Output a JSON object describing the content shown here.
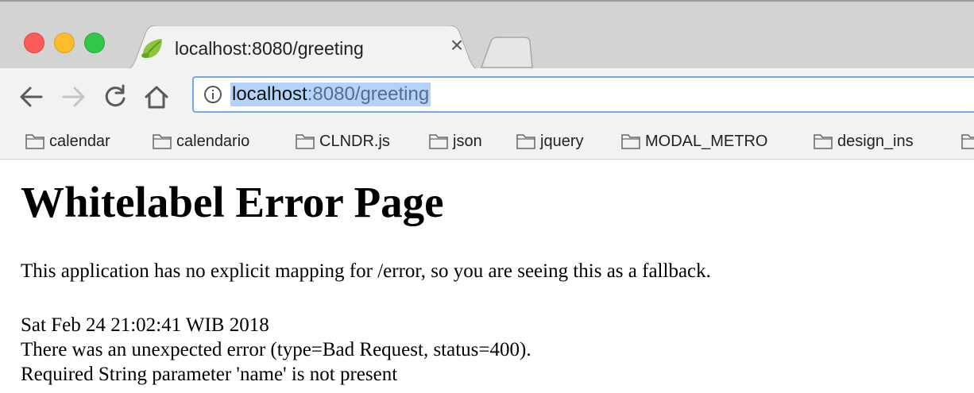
{
  "browser": {
    "tab": {
      "title": "localhost:8080/greeting",
      "close_glyph": "×",
      "favicon": "spring-leaf-icon"
    },
    "address_bar": {
      "host": "localhost",
      "rest": ":8080/greeting",
      "info_icon": "info-icon"
    },
    "toolbar_icons": [
      "back-arrow-icon",
      "forward-arrow-icon",
      "reload-icon",
      "home-icon"
    ],
    "bookmarks": [
      {
        "label": "calendar"
      },
      {
        "label": "calendario"
      },
      {
        "label": "CLNDR.js"
      },
      {
        "label": "json"
      },
      {
        "label": "jquery"
      },
      {
        "label": "MODAL_METRO"
      },
      {
        "label": "design_ins"
      }
    ],
    "colors": {
      "accent": "#74a7e8",
      "selection": "#b4d3fb",
      "close": "#fc5b57",
      "minimize": "#fdbc2e",
      "maximize": "#32c748"
    }
  },
  "page": {
    "title": "Whitelabel Error Page",
    "message": "This application has no explicit mapping for /error, so you are seeing this as a fallback.",
    "timestamp": "Sat Feb 24 21:02:41 WIB 2018",
    "error_line": "There was an unexpected error (type=Bad Request, status=400).",
    "detail": "Required String parameter 'name' is not present"
  }
}
